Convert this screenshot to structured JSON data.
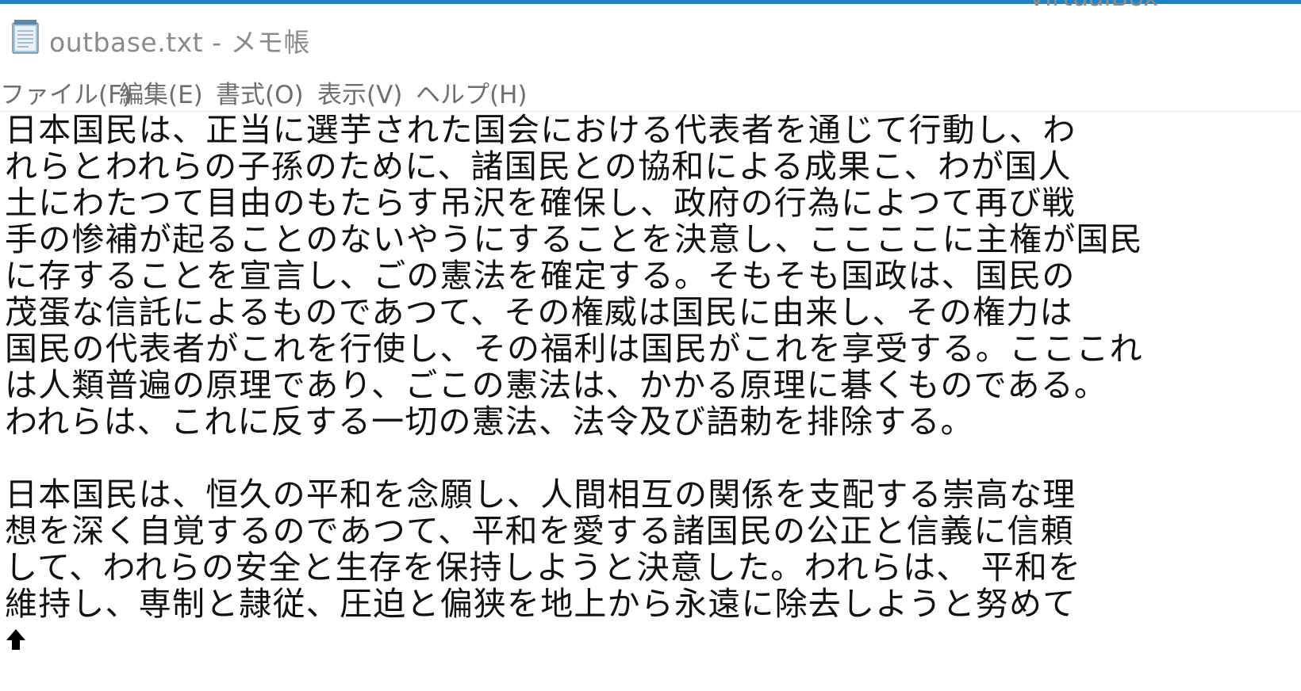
{
  "window": {
    "title": "outbase.txt - メモ帳",
    "top_right_text": "VirtualBox"
  },
  "menu": {
    "items": [
      {
        "label": "ファイル(F)"
      },
      {
        "label": "編集(E)"
      },
      {
        "label": "書式(O)"
      },
      {
        "label": "表示(V)"
      },
      {
        "label": "ヘルプ(H)"
      }
    ]
  },
  "editor": {
    "content": "日本国民は、正当に選芋された国会における代表者を通じて行動し、わ\nれらとわれらの子孫のために、諸国民との協和による成果こ、わが国人\n土にわたつて目由のもたらす吊沢を確保し、政府の行為によつて再び戦\n手の惨補が起ることのないやうにすることを決意し、ここここに主権が国民\nに存することを宣言し、ごの憲法を確定する。そもそも国政は、国民の\n茂蛋な信託によるものであつて、その権威は国民に由来し、その権力は\n国民の代表者がこれを行使し、その福利は国民がこれを享受する。こここれ\nは人類普遍の原理であり、ごこの憲法は、かかる原理に碁くものである。\nわれらは、これに反する一切の憲法、法令及び語勅を排除する。\n\n日本国民は、恒久の平和を念願し、人間相互の関係を支配する崇高な理\n想を深く自覚するのであつて、平和を愛する諸国民の公正と信義に信頼\nして、われらの安全と生存を保持しようと決意した。われらは、 平和を\n維持し、専制と隷従、圧迫と偏狭を地上から永遠に除去しようと努めて"
  },
  "colors": {
    "accent_strip": "#1a84c7",
    "title_text": "#8a8a8a",
    "menu_text": "#6e6e6e",
    "body_text": "#111111"
  },
  "icons": {
    "app": "notepad-icon",
    "cursor": "mouse-pointer-icon"
  }
}
